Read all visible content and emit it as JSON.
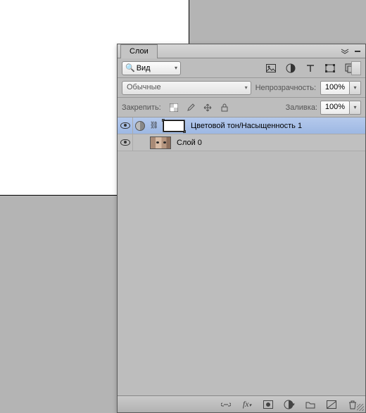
{
  "panel": {
    "tab": "Слои",
    "search": {
      "label": "Вид"
    },
    "blend_mode": "Обычные",
    "opacity": {
      "label": "Непрозрачность:",
      "value": "100%"
    },
    "lock": {
      "label": "Закрепить:"
    },
    "fill": {
      "label": "Заливка:",
      "value": "100%"
    }
  },
  "layers": [
    {
      "name": "Цветовой тон/Насыщенность 1",
      "selected": true,
      "type": "adjustment"
    },
    {
      "name": "Слой 0",
      "selected": false,
      "type": "image"
    }
  ],
  "icons": {
    "filter_image": "image-filter-icon",
    "filter_adjust": "adjustment-filter-icon",
    "filter_type": "type-filter-icon",
    "filter_shape": "shape-filter-icon",
    "filter_smart": "smartobject-filter-icon"
  }
}
